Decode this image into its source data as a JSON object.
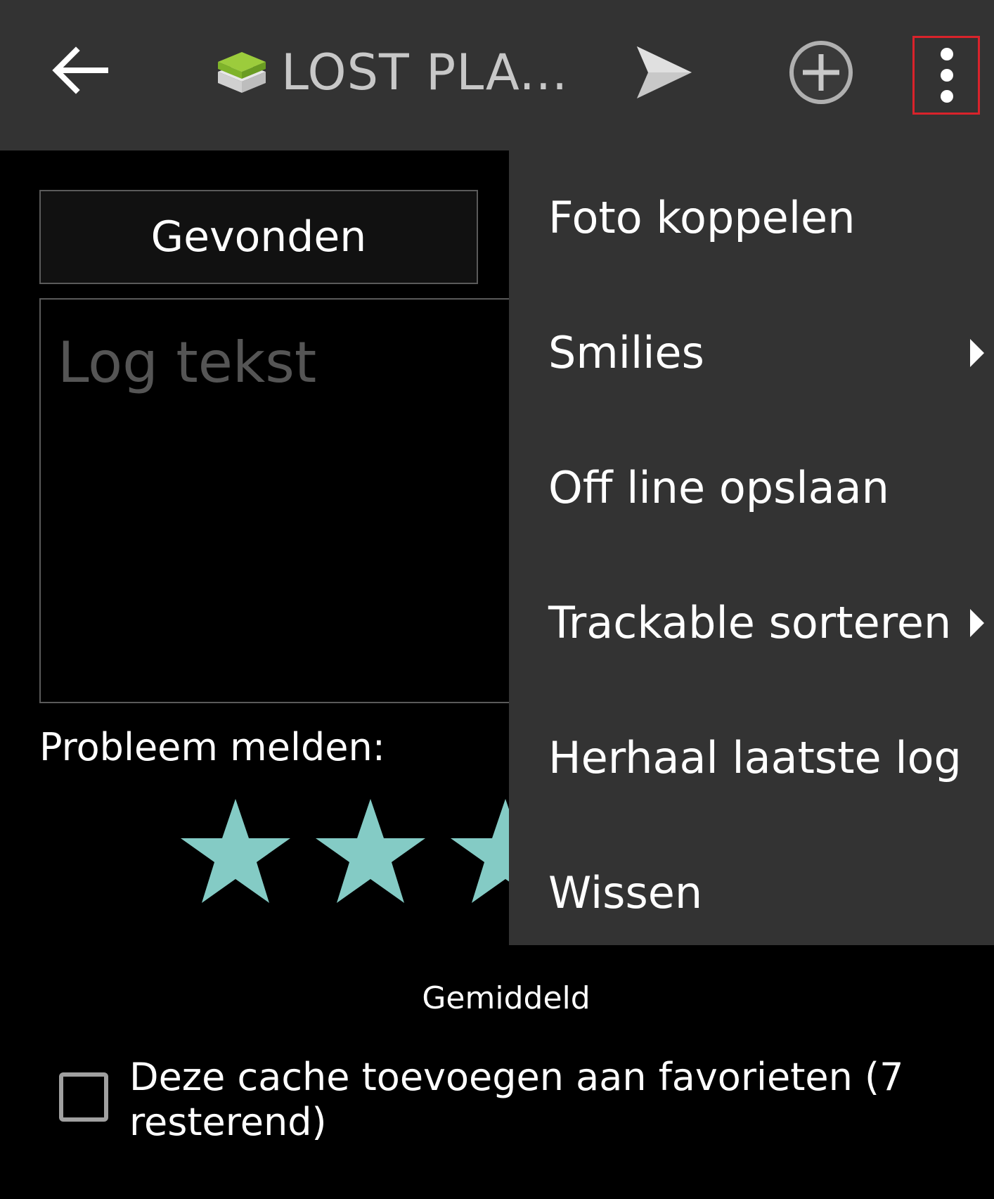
{
  "appbar": {
    "title": "LOST PLA...",
    "icons": [
      "back-arrow-icon",
      "cache-icon",
      "send-icon",
      "add-circle-icon",
      "overflow-menu-icon"
    ],
    "background": "#333333"
  },
  "log_type": {
    "selected": "Gevonden"
  },
  "log_text": {
    "placeholder": "Log tekst"
  },
  "problem": {
    "label": "Probleem melden:"
  },
  "rating": {
    "label": "Gemiddeld",
    "star_color": "#84cbc5"
  },
  "favorite": {
    "label": "Deze cache toevoegen aan favorieten (7 resterend)",
    "checked": false
  },
  "menu": {
    "items": [
      {
        "label": "Foto koppelen",
        "submenu": false
      },
      {
        "label": "Smilies",
        "submenu": true
      },
      {
        "label": "Off line opslaan",
        "submenu": false
      },
      {
        "label": "Trackable sorteren",
        "submenu": true
      },
      {
        "label": "Herhaal laatste log",
        "submenu": false
      },
      {
        "label": "Wissen",
        "submenu": false
      }
    ]
  },
  "highlight_color": "#d9232b"
}
